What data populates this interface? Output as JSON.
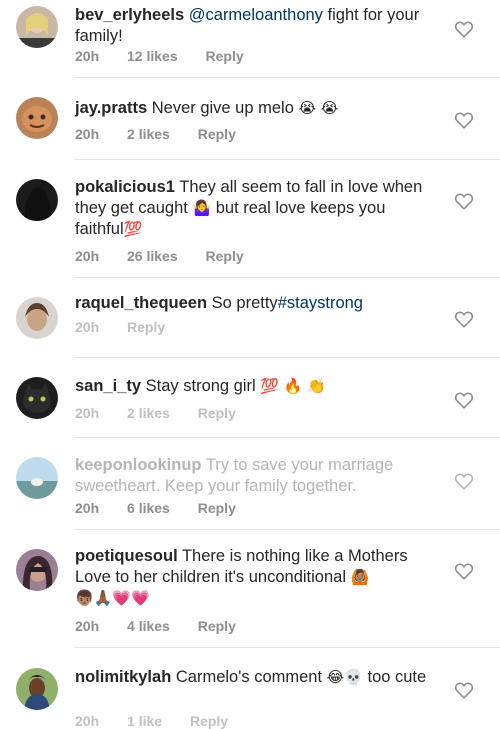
{
  "comments": [
    {
      "username": "bev_erlyheels",
      "mention": "@carmeloanthony",
      "text": "fight for your family!",
      "time": "20h",
      "likes": "12 likes",
      "reply": "Reply"
    },
    {
      "username": "jay.pratts",
      "text": "Never give up melo",
      "emoji": "😭 😭",
      "time": "20h",
      "likes": "2 likes",
      "reply": "Reply"
    },
    {
      "username": "pokalicious1",
      "text_a": "They all seem to fall in love when they get caught",
      "emoji_a": "🤷‍♀️",
      "text_b": "but real love keeps you faithful",
      "emoji_b": "💯",
      "time": "20h",
      "likes": "26 likes",
      "reply": "Reply"
    },
    {
      "username": "raquel_thequeen",
      "text": "So pretty",
      "hashtag": "#staystrong",
      "time": "20h",
      "reply": "Reply"
    },
    {
      "username": "san_i_ty",
      "text": "Stay strong girl",
      "emoji": "💯 🔥 👏",
      "time": "20h",
      "likes": "2 likes",
      "reply": "Reply"
    },
    {
      "username": "keeponlookinup",
      "text": "Try to save your marriage sweetheart. Keep your family together.",
      "time": "20h",
      "likes": "6 likes",
      "reply": "Reply"
    },
    {
      "username": "poetiquesoul",
      "text": "There is nothing like a Mothers Love to her children it's unconditional",
      "emoji_a": "🙆🏽",
      "emoji_b": "👦🏽🙏🏾💗💗",
      "time": "20h",
      "likes": "4 likes",
      "reply": "Reply"
    },
    {
      "username": "nolimitkylah",
      "text_a": "Carmelo's comment",
      "emoji": "😂💀",
      "text_b": "too cute",
      "time": "20h",
      "likes": "1 like",
      "reply": "Reply"
    }
  ],
  "colors": {
    "text": "#262626",
    "meta": "#8e8e8e",
    "link": "#003569",
    "divider": "#e6e6e6"
  },
  "icons": {
    "like": "heart-outline-icon"
  }
}
